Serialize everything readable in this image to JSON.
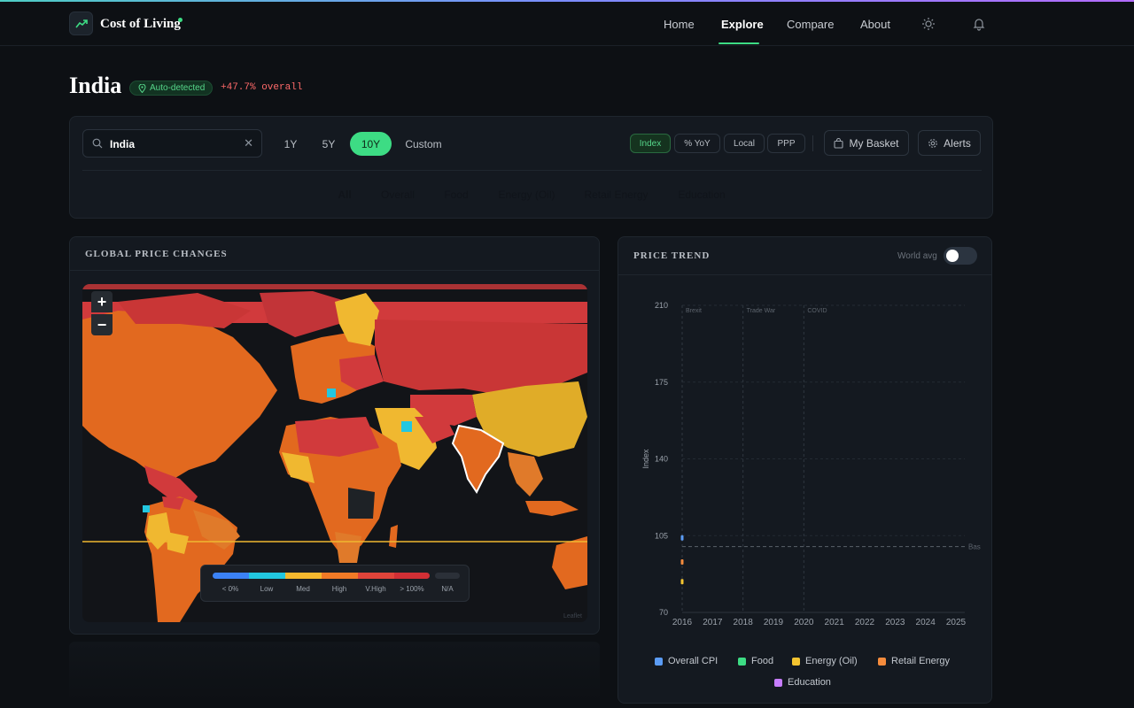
{
  "app": {
    "title": "Cost of Living"
  },
  "nav": {
    "items": [
      {
        "label": "Home",
        "active": false
      },
      {
        "label": "Explore",
        "active": true
      },
      {
        "label": "Compare",
        "active": false
      },
      {
        "label": "About",
        "active": false
      }
    ],
    "icons": [
      "sun-icon",
      "bell-icon"
    ],
    "accent": "#3ddc84"
  },
  "header": {
    "country": "India",
    "badge": "Auto-detected",
    "overall_change": "+47.7% overall"
  },
  "controls": {
    "search_value": "India",
    "clear_symbol": "✕",
    "ranges": [
      {
        "label": "1Y",
        "active": false
      },
      {
        "label": "5Y",
        "active": false
      },
      {
        "label": "10Y",
        "active": true
      },
      {
        "label": "Custom",
        "active": false
      }
    ],
    "modes": [
      {
        "label": "Index",
        "active": true
      },
      {
        "label": "% YoY",
        "active": false
      },
      {
        "label": "Local",
        "active": false
      },
      {
        "label": "PPP",
        "active": false
      }
    ],
    "basket_label": "My Basket",
    "alerts_label": "Alerts",
    "categories": [
      {
        "label": "All",
        "color": "#e9eaec"
      },
      {
        "label": "Overall",
        "color": "#5b9cf5"
      },
      {
        "label": "Food",
        "color": "#3ddc84"
      },
      {
        "label": "Energy (Oil)",
        "color": "#f4c430"
      },
      {
        "label": "Retail Energy",
        "color": "#f58b3c"
      },
      {
        "label": "Education",
        "color": "#c77dff"
      }
    ]
  },
  "map": {
    "title": "GLOBAL PRICE CHANGES",
    "zoom_in": "+",
    "zoom_out": "−",
    "legend": [
      {
        "label": "< 0%",
        "color": "#3b82f6"
      },
      {
        "label": "Low",
        "color": "#22c7e0"
      },
      {
        "label": "Med",
        "color": "#f5b82e"
      },
      {
        "label": "High",
        "color": "#f07a26"
      },
      {
        "label": "V.High",
        "color": "#e0443a"
      },
      {
        "label": "> 100%",
        "color": "#d12f35"
      },
      {
        "label": "N/A",
        "color": "#2b3038"
      }
    ],
    "attribution": "Leaflet"
  },
  "trend": {
    "title": "PRICE TREND",
    "toggle_label": "World avg",
    "toggle_on": false
  },
  "chart_data": {
    "type": "line",
    "title": "",
    "xlabel": "",
    "ylabel": "Index",
    "x": [
      "2016",
      "2017",
      "2018",
      "2019",
      "2020",
      "2021",
      "2022",
      "2023",
      "2024",
      "2025"
    ],
    "ylim": [
      70,
      210
    ],
    "yticks": [
      70,
      105,
      140,
      175,
      210
    ],
    "baseline": {
      "value": 100,
      "label": "Bas"
    },
    "events": [
      {
        "x": "2016",
        "label": "Brexit"
      },
      {
        "x": "2018",
        "label": "Trade War"
      },
      {
        "x": "2020",
        "label": "COVID"
      }
    ],
    "series": [
      {
        "name": "Overall CPI",
        "color": "#5b9cf5",
        "values": [
          {
            "x": "2016",
            "y": 104
          }
        ]
      },
      {
        "name": "Food",
        "color": "#3ddc84",
        "values": []
      },
      {
        "name": "Energy (Oil)",
        "color": "#f4c430",
        "values": [
          {
            "x": "2016",
            "y": 84
          }
        ]
      },
      {
        "name": "Retail Energy",
        "color": "#f58b3c",
        "values": [
          {
            "x": "2016",
            "y": 93
          }
        ]
      },
      {
        "name": "Education",
        "color": "#c77dff",
        "values": []
      }
    ],
    "grid": true,
    "legend_position": "bottom"
  }
}
